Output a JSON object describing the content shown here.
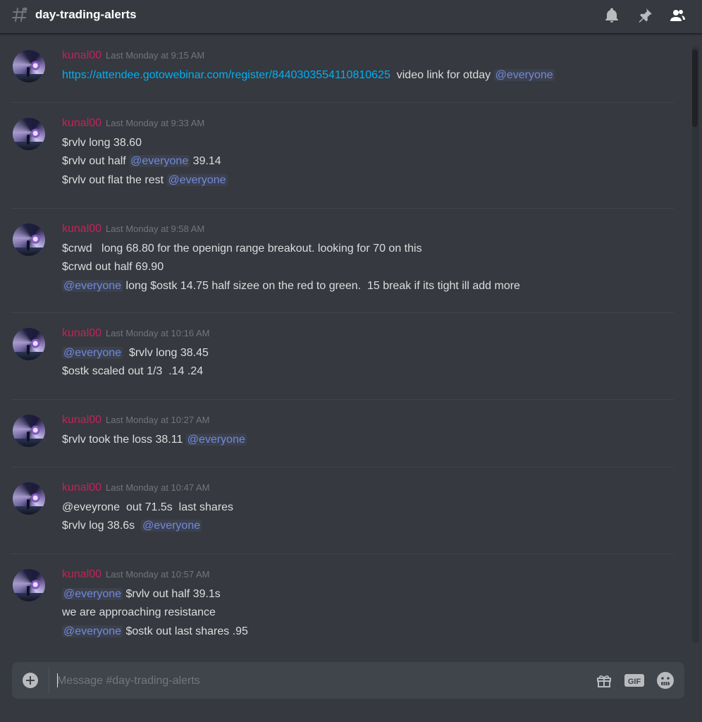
{
  "header": {
    "channel_name": "day-trading-alerts"
  },
  "messages": [
    {
      "author": "kunal00",
      "timestamp": "Last Monday at 9:15 AM",
      "lines": [
        [
          {
            "type": "link",
            "text": "https://attendee.gotowebinar.com/register/8440303554110810625"
          },
          {
            "type": "text",
            "text": "  video link for otday "
          },
          {
            "type": "mention",
            "text": "@everyone"
          }
        ]
      ]
    },
    {
      "author": "kunal00",
      "timestamp": "Last Monday at 9:33 AM",
      "lines": [
        [
          {
            "type": "text",
            "text": "$rvlv long 38.60"
          }
        ],
        [
          {
            "type": "text",
            "text": "$rvlv out half "
          },
          {
            "type": "mention",
            "text": "@everyone"
          },
          {
            "type": "text",
            "text": " 39.14"
          }
        ],
        [
          {
            "type": "text",
            "text": "$rvlv out flat the rest "
          },
          {
            "type": "mention",
            "text": "@everyone"
          }
        ]
      ]
    },
    {
      "author": "kunal00",
      "timestamp": "Last Monday at 9:58 AM",
      "lines": [
        [
          {
            "type": "text",
            "text": "$crwd   long 68.80 for the openign range breakout. looking for 70 on this"
          }
        ],
        [
          {
            "type": "text",
            "text": "$crwd out half 69.90"
          }
        ],
        [
          {
            "type": "mention",
            "text": "@everyone"
          },
          {
            "type": "text",
            "text": " long $ostk 14.75 half sizee on the red to green.  15 break if its tight ill add more"
          }
        ]
      ]
    },
    {
      "author": "kunal00",
      "timestamp": "Last Monday at 10:16 AM",
      "lines": [
        [
          {
            "type": "mention",
            "text": "@everyone"
          },
          {
            "type": "text",
            "text": "  $rvlv long 38.45"
          }
        ],
        [
          {
            "type": "text",
            "text": "$ostk scaled out 1/3  .14 .24"
          }
        ]
      ]
    },
    {
      "author": "kunal00",
      "timestamp": "Last Monday at 10:27 AM",
      "lines": [
        [
          {
            "type": "text",
            "text": "$rvlv took the loss 38.11 "
          },
          {
            "type": "mention",
            "text": "@everyone"
          }
        ]
      ]
    },
    {
      "author": "kunal00",
      "timestamp": "Last Monday at 10:47 AM",
      "lines": [
        [
          {
            "type": "text",
            "text": "@eveyrone  out 71.5s  last shares"
          }
        ],
        [
          {
            "type": "text",
            "text": "$rvlv log 38.6s  "
          },
          {
            "type": "mention",
            "text": "@everyone"
          }
        ]
      ]
    },
    {
      "author": "kunal00",
      "timestamp": "Last Monday at 10:57 AM",
      "lines": [
        [
          {
            "type": "mention",
            "text": "@everyone"
          },
          {
            "type": "text",
            "text": " $rvlv out half 39.1s"
          }
        ],
        [
          {
            "type": "text",
            "text": "we are approaching resistance"
          }
        ],
        [
          {
            "type": "mention",
            "text": "@everyone"
          },
          {
            "type": "text",
            "text": " $ostk out last shares .95"
          }
        ]
      ]
    }
  ],
  "composer": {
    "placeholder": "Message #day-trading-alerts"
  },
  "icons": {
    "channel": "hashtag-icon",
    "notifications": "bell-icon",
    "pins": "pin-icon",
    "members": "members-icon",
    "upload": "add-icon",
    "gift": "gift-icon",
    "gif": "gif-icon",
    "emoji": "emoji-icon"
  },
  "colors": {
    "background": "#36393f",
    "author": "#c0245a",
    "mention": "#7289da",
    "link": "#00b0f4",
    "text": "#dcddde",
    "timestamp": "#72767d"
  }
}
